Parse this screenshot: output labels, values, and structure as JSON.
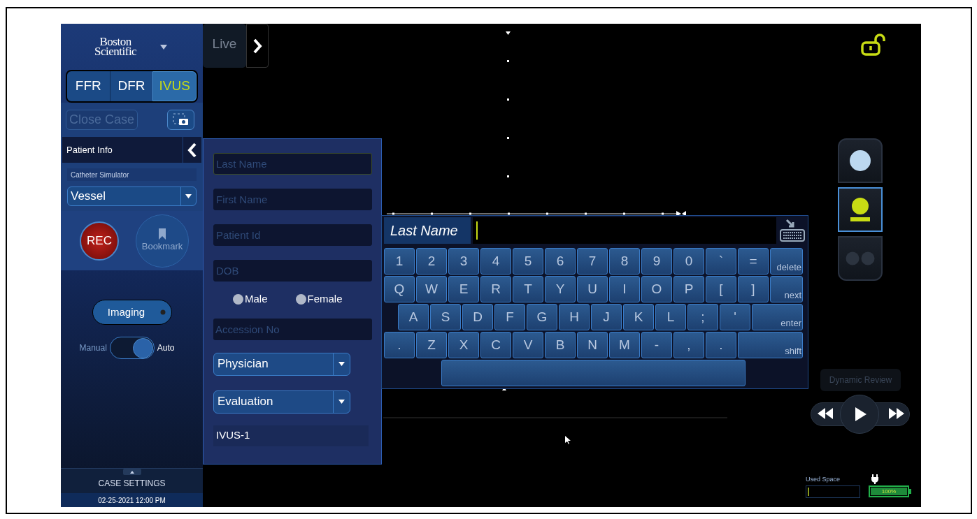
{
  "sidebar": {
    "logo_lines": [
      "Boston",
      "Scientific"
    ],
    "modes": [
      {
        "label": "FFR",
        "selected": false
      },
      {
        "label": "DFR",
        "selected": false
      },
      {
        "label": "IVUS",
        "selected": true
      }
    ],
    "close_case": {
      "label": "Close Case",
      "disabled": true
    },
    "patient_info": {
      "title": "Patient Info"
    },
    "catheter": {
      "label": "Catheter Simulator",
      "value": "Vessel"
    },
    "rec_button": "REC",
    "bookmark_button": "Bookmark",
    "imaging_button": "Imaging",
    "mode_switch": {
      "left": "Manual",
      "right": "Auto",
      "on": true
    },
    "case_settings": "CASE SETTINGS",
    "datetime": "02-25-2021 12:00 PM"
  },
  "live_tab": "Live",
  "patient_form": {
    "fields": [
      {
        "placeholder": "Last Name",
        "focused": true
      },
      {
        "placeholder": "First Name",
        "focused": false
      },
      {
        "placeholder": "Patient Id",
        "focused": false
      },
      {
        "placeholder": "DOB",
        "focused": false
      }
    ],
    "gender": [
      {
        "label": "Male",
        "selected": false
      },
      {
        "label": "Female",
        "selected": false
      }
    ],
    "accession": {
      "placeholder": "Accession No"
    },
    "dropdowns": [
      "Physician",
      "Evaluation"
    ],
    "study": "IVUS-1"
  },
  "keyboard": {
    "field_label": "Last Name",
    "rows": [
      [
        {
          "kind": "char",
          "label": "1"
        },
        {
          "kind": "char",
          "label": "2"
        },
        {
          "kind": "char",
          "label": "3"
        },
        {
          "kind": "char",
          "label": "4"
        },
        {
          "kind": "char",
          "label": "5"
        },
        {
          "kind": "char",
          "label": "6"
        },
        {
          "kind": "char",
          "label": "7"
        },
        {
          "kind": "char",
          "label": "8"
        },
        {
          "kind": "char",
          "label": "9"
        },
        {
          "kind": "char",
          "label": "0"
        },
        {
          "kind": "char",
          "label": "`"
        },
        {
          "kind": "char",
          "label": "="
        },
        {
          "kind": "action",
          "label": "delete"
        }
      ],
      [
        {
          "kind": "char",
          "label": "Q"
        },
        {
          "kind": "char",
          "label": "W"
        },
        {
          "kind": "char",
          "label": "E"
        },
        {
          "kind": "char",
          "label": "R"
        },
        {
          "kind": "char",
          "label": "T"
        },
        {
          "kind": "char",
          "label": "Y"
        },
        {
          "kind": "char",
          "label": "U"
        },
        {
          "kind": "char",
          "label": "I"
        },
        {
          "kind": "char",
          "label": "O"
        },
        {
          "kind": "char",
          "label": "P"
        },
        {
          "kind": "char",
          "label": "["
        },
        {
          "kind": "char",
          "label": "]"
        },
        {
          "kind": "action",
          "label": "next"
        }
      ],
      [
        {
          "kind": "char",
          "label": "A"
        },
        {
          "kind": "char",
          "label": "S"
        },
        {
          "kind": "char",
          "label": "D"
        },
        {
          "kind": "char",
          "label": "F"
        },
        {
          "kind": "char",
          "label": "G"
        },
        {
          "kind": "char",
          "label": "H"
        },
        {
          "kind": "char",
          "label": "J"
        },
        {
          "kind": "char",
          "label": "K"
        },
        {
          "kind": "char",
          "label": "L"
        },
        {
          "kind": "char",
          "label": ";"
        },
        {
          "kind": "char",
          "label": "'"
        },
        {
          "kind": "action",
          "label": "enter"
        }
      ],
      [
        {
          "kind": "char",
          "label": "."
        },
        {
          "kind": "char",
          "label": "Z"
        },
        {
          "kind": "char",
          "label": "X"
        },
        {
          "kind": "char",
          "label": "C"
        },
        {
          "kind": "char",
          "label": "V"
        },
        {
          "kind": "char",
          "label": "B"
        },
        {
          "kind": "char",
          "label": "N"
        },
        {
          "kind": "char",
          "label": "M"
        },
        {
          "kind": "char",
          "label": "-"
        },
        {
          "kind": "char",
          "label": ","
        },
        {
          "kind": "char",
          "label": "."
        },
        {
          "kind": "action",
          "label": "shift"
        }
      ],
      [
        {
          "kind": "space"
        }
      ]
    ]
  },
  "view_buttons": [
    {
      "kind": "circle",
      "selected": false
    },
    {
      "kind": "person",
      "selected": true
    },
    {
      "kind": "dual",
      "selected": false
    }
  ],
  "dynamic_review": {
    "label": "Dynamic Review",
    "disabled": true
  },
  "storage": {
    "label": "Used Space",
    "level": 0.01
  },
  "battery": {
    "reading": "100%",
    "level": 1,
    "plugged": true
  }
}
